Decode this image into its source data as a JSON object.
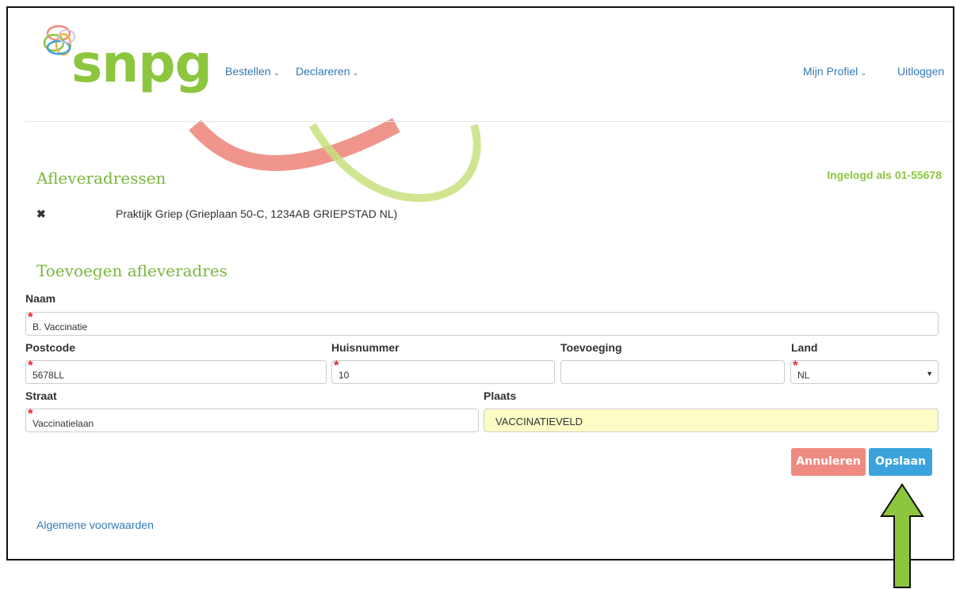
{
  "brand": {
    "logo_text": "snpg",
    "colors": {
      "green": "#8cc63f",
      "red": "#ee8a80",
      "blue": "#3aa3dc",
      "highlight": "#fbfcc6"
    }
  },
  "nav": {
    "left": [
      {
        "label": "Bestellen",
        "icon": "chevron-down-icon"
      },
      {
        "label": "Declareren",
        "icon": "chevron-down-icon"
      }
    ],
    "right": [
      {
        "label": "Mijn Profiel",
        "icon": "chevron-down-icon"
      },
      {
        "label": "Uitloggen"
      }
    ]
  },
  "status": {
    "logged_in": "Ingelogd als 01-55678"
  },
  "addresses": {
    "title": "Afleveradressen",
    "items": [
      {
        "text": "Praktijk Griep (Grieplaan 50-C, 1234AB GRIEPSTAD NL)",
        "icon": "delete-x-icon"
      }
    ]
  },
  "form": {
    "title": "Toevoegen afleveradres",
    "required_mark": "*",
    "fields": {
      "naam": {
        "label": "Naam",
        "value": "B. Vaccinatie"
      },
      "postcode": {
        "label": "Postcode",
        "value": "5678LL"
      },
      "huisnummer": {
        "label": "Huisnummer",
        "value": "10"
      },
      "toevoeging": {
        "label": "Toevoeging",
        "value": ""
      },
      "land": {
        "label": "Land",
        "value": "NL"
      },
      "straat": {
        "label": "Straat",
        "value": "Vaccinatielaan"
      },
      "plaats": {
        "label": "Plaats",
        "value": "VACCINATIEVELD"
      }
    },
    "buttons": {
      "cancel": "Annuleren",
      "save": "Opslaan"
    }
  },
  "footer": {
    "link": "Algemene voorwaarden"
  }
}
